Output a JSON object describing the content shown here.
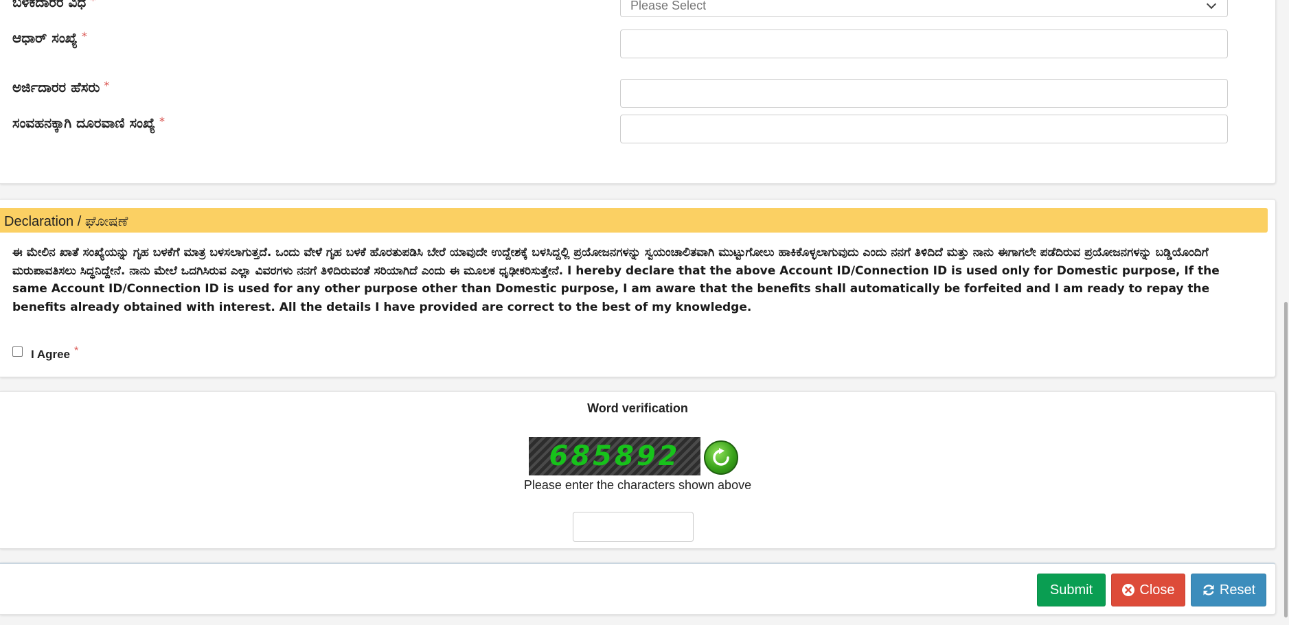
{
  "form": {
    "fields": [
      {
        "label": "ಬಳಕದಾರರ ವಿಧ",
        "required": "*",
        "type": "select",
        "value": "Please Select"
      },
      {
        "label": "ಆಧಾರ್ ಸಂಖ್ಯೆ",
        "required": "*",
        "type": "text",
        "value": ""
      },
      {
        "label": "ಅರ್ಜಿದಾರರ ಹೆಸರು",
        "required": "*",
        "type": "text",
        "value": ""
      },
      {
        "label": "ಸಂವಹನಕ್ಕಾಗಿ ದೂರವಾಣಿ ಸಂಖ್ಯೆ",
        "required": "*",
        "type": "text",
        "value": ""
      }
    ]
  },
  "declaration": {
    "header_en": "Declaration / ",
    "header_kn": "ಘೋಷಣೆ",
    "text": "ಈ ಮೇಲಿನ ಖಾತೆ ಸಂಖ್ಯೆಯನ್ನು ಗೃಹ ಬಳಕೆಗೆ ಮಾತ್ರ ಬಳಸಲಾಗುತ್ತದೆ. ಒಂದು ವೇಳೆ ಗೃಹ ಬಳಕೆ ಹೊರತುಪಡಿಸಿ ಬೇರೆ ಯಾವುದೇ ಉದ್ದೇಶಕ್ಕೆ ಬಳಸಿದ್ದಲ್ಲಿ ಪ್ರಯೋಜನಗಳನ್ನು ಸ್ವಯಂಚಾಲಿತವಾಗಿ ಮುಟ್ಟುಗೋಲು ಹಾಕಿಕೊಳ್ಳಲಾಗುವುದು ಎಂದು ನನಗೆ ತಿಳಿದಿದೆ ಮತ್ತು ನಾನು ಈಗಾಗಲೇ ಪಡೆದಿರುವ ಪ್ರಯೋಜನಗಳನ್ನು ಬಡ್ಡಿಯೊಂದಿಗೆ ಮರುಪಾವತಿಸಲು ಸಿದ್ಧನಿದ್ದೇನೆ. ನಾನು ಮೇಲೆ ಒದಗಿಸಿರುವ ಎಲ್ಲಾ ವಿವರಗಳು ನನಗೆ ತಿಳಿದಿರುವಂತೆ ಸರಿಯಾಗಿದೆ ಎಂದು ಈ ಮೂಲಕ ಧೃಢೀಕರಿಸುತ್ತೇನೆ. I hereby declare that the above Account ID/Connection ID is used only for Domestic purpose, If the same Account ID/Connection ID is used for any other purpose other than Domestic purpose, I am aware that the benefits shall automatically be forfeited and I am ready to repay the benefits already obtained with interest. All the details I have provided are correct to the best of my knowledge.",
    "agree_label": "I Agree",
    "agree_required": "*"
  },
  "captcha": {
    "title": "Word verification",
    "code": "685892",
    "hint": "Please enter the characters shown above",
    "input_value": "",
    "colors": {
      "text": "#17c21b",
      "background": "#333333"
    },
    "refresh_icon": "refresh-arrow-icon"
  },
  "actions": {
    "submit": "Submit",
    "close": "Close",
    "reset": "Reset",
    "colors": {
      "submit": "#0a9e52",
      "close": "#dd4b39",
      "reset": "#3c8dbc"
    },
    "icons": {
      "close": "circle-x-icon",
      "reset": "refresh-icon"
    }
  },
  "theme": {
    "declaration_header_bg": "#fbd063",
    "required_color": "#d9534f"
  }
}
